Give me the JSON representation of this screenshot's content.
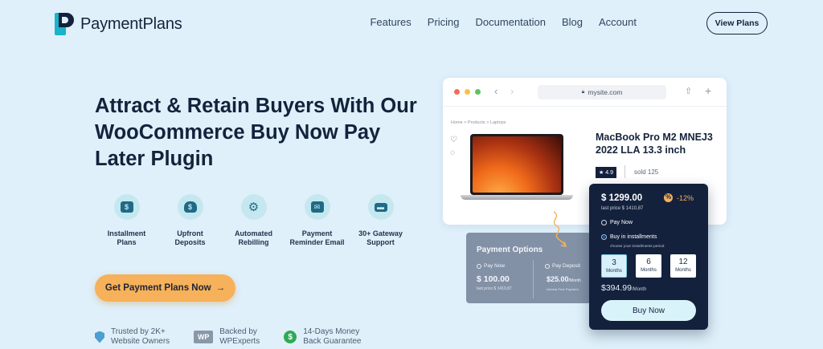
{
  "brand": {
    "name": "PaymentPlans"
  },
  "nav": {
    "items": [
      "Features",
      "Pricing",
      "Documentation",
      "Blog",
      "Account"
    ],
    "cta": "View Plans"
  },
  "hero": {
    "headline": "Attract & Retain Buyers With Our WooCommerce Buy Now Pay Later Plugin",
    "features": [
      {
        "icon": "calendar-dollar-icon",
        "label": "Installment Plans"
      },
      {
        "icon": "money-bag-icon",
        "label": "Upfront Deposits"
      },
      {
        "icon": "gears-icon",
        "label": "Automated Rebilling"
      },
      {
        "icon": "email-reminder-icon",
        "label": "Payment Reminder Email"
      },
      {
        "icon": "credit-card-icon",
        "label": "30+ Gateway Support"
      }
    ],
    "cta_label": "Get Payment Plans Now",
    "cta_arrow": "→",
    "trust": [
      {
        "line1": "Trusted by 2K+",
        "line2": "Website Owners"
      },
      {
        "badge": "WP",
        "line1": "Backed by",
        "line2": "WPExperts"
      },
      {
        "badge": "$",
        "line1": "14-Days Money",
        "line2": "Back Guarantee"
      }
    ]
  },
  "browser": {
    "url": "mysite.com",
    "breadcrumb": "Home  >  Products  >  Laptops",
    "product_title": "MacBook Pro M2 MNEJ3 2022 LLA 13.3 inch",
    "rating": "4.9",
    "sold": "sold 125"
  },
  "payment_options": {
    "title": "Payment Options",
    "pay_now_label": "Pay Now",
    "pay_now_price": "$ 100.00",
    "pay_now_last": "last price   $ 1410,87",
    "deposit_label": "Pay Deposit",
    "deposit_price": "$25.00",
    "deposit_unit": "/Month",
    "deposit_note": "Interest Free Payment"
  },
  "pay_card": {
    "price": "$ 1299.00",
    "last_price": "last price     $ 1410,87",
    "discount": "-12%",
    "pay_now_label": "Pay Now",
    "installments_label": "Buy in installments",
    "installments_hint": "choose your installments period",
    "months": [
      {
        "value": "3",
        "unit": "Months",
        "selected": true
      },
      {
        "value": "6",
        "unit": "Months",
        "selected": false
      },
      {
        "value": "12",
        "unit": "Months",
        "selected": false
      }
    ],
    "monthly_price": "$394.99",
    "monthly_unit": "/Month",
    "buy_label": "Buy Now"
  },
  "colors": {
    "background": "#dff0fb",
    "navy": "#14213d",
    "accent_orange": "#f6b15a",
    "teal": "#1ab3c9"
  }
}
